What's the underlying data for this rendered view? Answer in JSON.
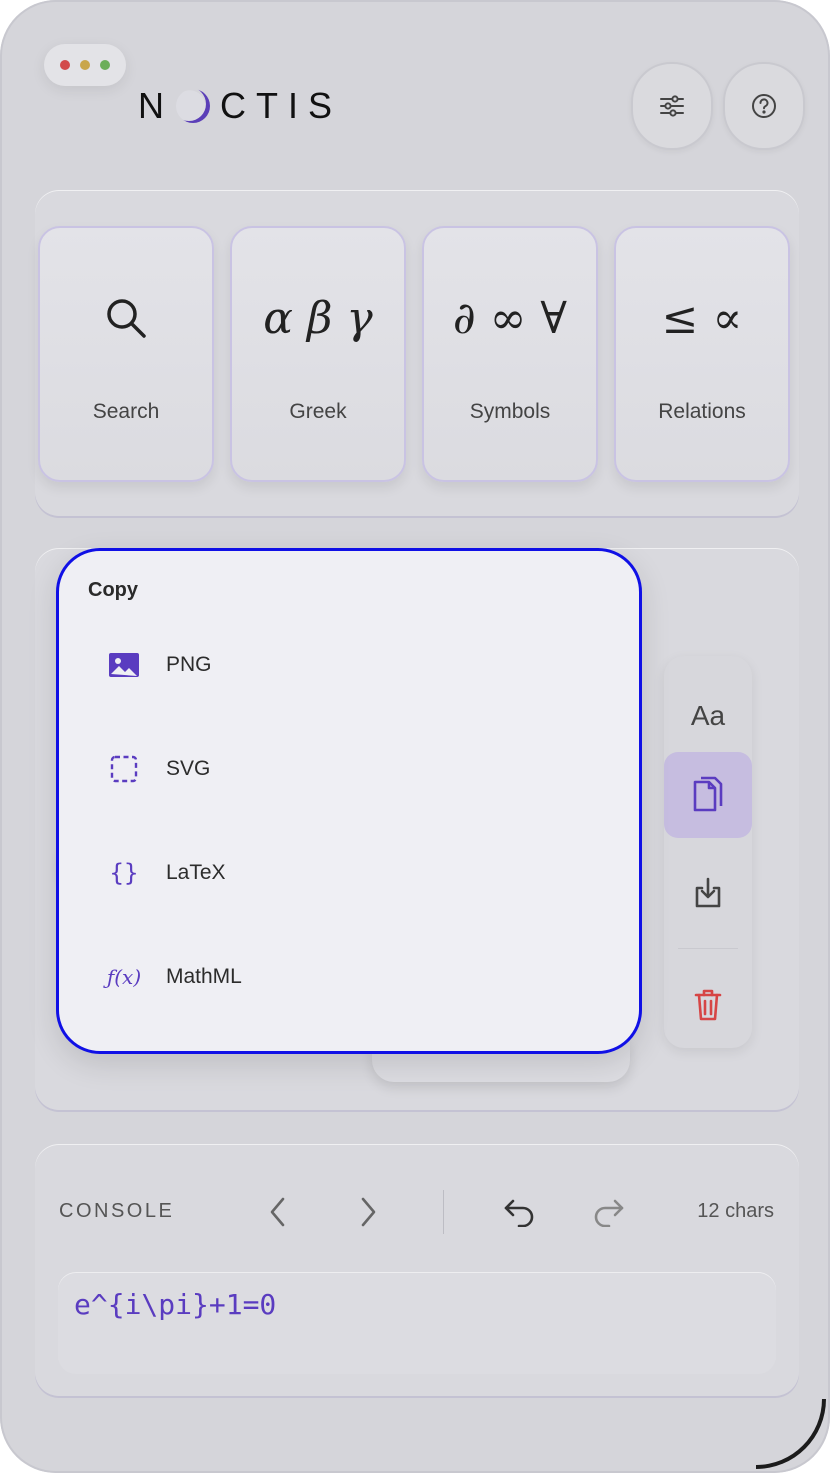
{
  "app": {
    "logo_text": "NOCTIS",
    "logo_left": "N",
    "logo_right": "CTIS"
  },
  "window_controls": {
    "colors": [
      "#d24a4a",
      "#c9a64a",
      "#6cae5a"
    ]
  },
  "header_buttons": [
    {
      "icon": "sliders-icon"
    },
    {
      "icon": "help-icon"
    }
  ],
  "categories": [
    {
      "label": "Search",
      "glyph": "search-icon"
    },
    {
      "label": "Greek",
      "glyph": "α β γ"
    },
    {
      "label": "Symbols",
      "glyph": "∂ ∞ ∀"
    },
    {
      "label": "Relations",
      "glyph": "≤ ∝"
    }
  ],
  "toolbar": {
    "font_label": "Aa",
    "items": [
      "font-style-icon",
      "copy-icon",
      "export-icon",
      "trash-icon"
    ],
    "active": "copy-icon"
  },
  "copy_menu": {
    "title": "Copy",
    "options": [
      {
        "label": "PNG",
        "icon": "image-icon"
      },
      {
        "label": "SVG",
        "icon": "vector-frame-icon"
      },
      {
        "label": "LaTeX",
        "icon": "braces-icon",
        "icon_text": "{}"
      },
      {
        "label": "MathML",
        "icon": "function-icon",
        "icon_text": "ƒ(x)"
      }
    ]
  },
  "console": {
    "label": "CONSOLE",
    "char_count": "12 chars",
    "input": "e^{i\\pi}+1=0"
  },
  "colors": {
    "accent": "#5a3cc0",
    "highlight_border": "#1010e6",
    "danger": "#d64545"
  }
}
